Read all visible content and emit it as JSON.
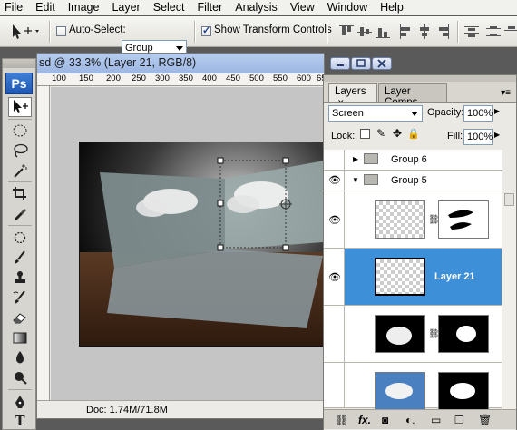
{
  "menu": [
    "File",
    "Edit",
    "Image",
    "Layer",
    "Select",
    "Filter",
    "Analysis",
    "View",
    "Window",
    "Help"
  ],
  "options": {
    "auto_select_label": "Auto-Select:",
    "auto_select_value": "Group",
    "show_transform_label": "Show Transform Controls"
  },
  "document": {
    "title": "sd @ 33.3% (Layer 21, RGB/8)",
    "ruler_ticks": [
      "100",
      "150",
      "200",
      "250",
      "300",
      "350",
      "400",
      "450",
      "500",
      "550",
      "600",
      "65"
    ],
    "status": "Doc: 1.74M/71.8M"
  },
  "tools": {
    "logo": "Ps"
  },
  "layers": {
    "tabs": [
      "Layers",
      "Layer Comps"
    ],
    "blend_mode": "Screen",
    "opacity_label": "Opacity:",
    "opacity_value": "100%",
    "lock_label": "Lock:",
    "fill_label": "Fill:",
    "fill_value": "100%",
    "rows": [
      {
        "name": "Group 6"
      },
      {
        "name": "Group 5"
      },
      {
        "name": ""
      },
      {
        "name": "Layer 21"
      },
      {
        "name": ""
      },
      {
        "name": ""
      }
    ]
  },
  "colors": {
    "selection_blue": "#3d8fd8",
    "title_blue": "#9cb6e2"
  }
}
